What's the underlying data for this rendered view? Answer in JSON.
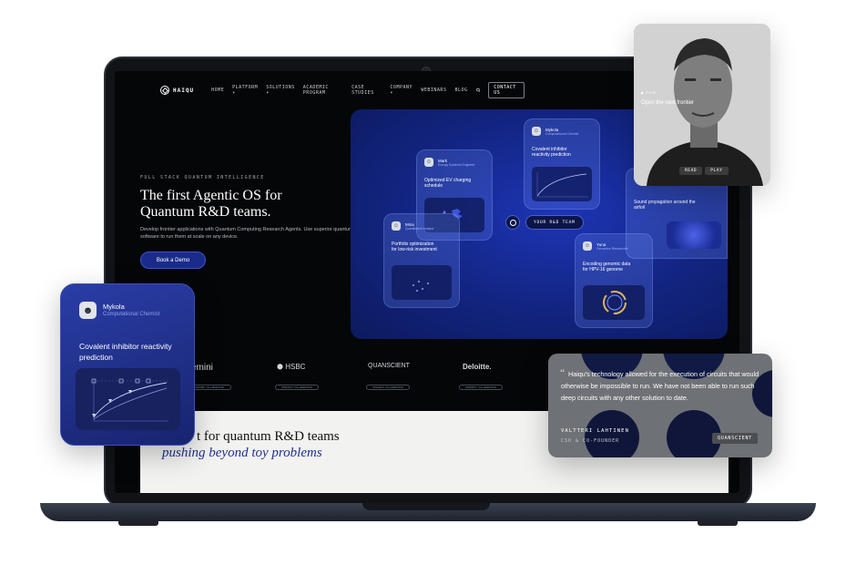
{
  "nav": {
    "brand": "HAIQU",
    "items": [
      "HOME",
      "PLATFORM ▾",
      "SOLUTIONS ▾",
      "ACADEMIC PROGRAM",
      "CASE STUDIES",
      "COMPANY ▾",
      "WEBINARS",
      "BLOG"
    ],
    "contact": "CONTACT US"
  },
  "hero": {
    "eyebrow": "FULL STACK QUANTUM INTELLIGENCE",
    "title_line1": "The first Agentic OS for",
    "title_line2": "Quantum R&D teams.",
    "subtitle": "Develop frontier applications with Quantum Computing Research Agents. Use superior quantum software to run them at scale on any device.",
    "cta": "Book a Demo"
  },
  "panel": {
    "center_label": "YOUR R&D TEAM",
    "agents": [
      {
        "name": "Mark",
        "role": "Energy Systems Engineer",
        "title": "Optimized EV charging schedule"
      },
      {
        "name": "Mykola",
        "role": "Computational Chemist",
        "title": "Covalent inhibitor reactivity prediction"
      },
      {
        "name": "Mirai",
        "role": "Quantitative Analyst",
        "title": "Portfolio optimization for low-risk investment"
      },
      {
        "name": "Yuna",
        "role": "Genomics Researcher",
        "title": "Encoding genomic data for HPV-16 genome"
      },
      {
        "name": "",
        "role": "",
        "title": "Sound propagation around the airfoil"
      }
    ]
  },
  "logos": [
    {
      "name": "emini",
      "tag": "PARTNER COLLABORATION"
    },
    {
      "name": "HSBC",
      "tag": "RESEARCH COLLABORATION"
    },
    {
      "name": "QUANSCIENT",
      "tag": "RESEARCH COLLABORATION"
    },
    {
      "name": "Deloitte.",
      "tag": "BUSINESS COLLABORATION"
    }
  ],
  "section": {
    "line1": "t for quantum R&D teams",
    "line2": "pushing beyond toy problems"
  },
  "card_chem": {
    "name": "Mykola",
    "role": "Computational Chemist",
    "title": "Covalent inhibitor reactivity prediction"
  },
  "card_portrait": {
    "tag": "■ FILM",
    "headline": "Open the next frontier",
    "buttons": [
      "READ",
      "PLAY"
    ]
  },
  "card_quote": {
    "text": "Haiqu's technology allowed for the execution of circuits that would otherwise be impossible to run. We have not been able to run such deep circuits with any other solution to date.",
    "author": "VALTTERI LAHTINEN",
    "role": "CSO & CO-FOUNDER",
    "company": "QUANSCIENT"
  },
  "colors": {
    "brand_blue": "#1b2b8a",
    "panel_blue": "#1d35b6"
  }
}
